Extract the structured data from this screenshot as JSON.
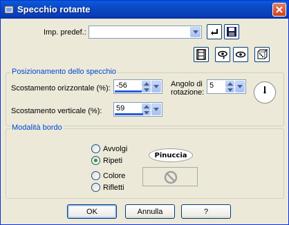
{
  "window": {
    "title": "Specchio rotante"
  },
  "preset": {
    "label": "Imp. predef.:",
    "value": ""
  },
  "mirror_group": {
    "legend": "Posizionamento dello specchio",
    "h_offset_label": "Scostamento orizzontale (%):",
    "h_offset_value": "-56",
    "v_offset_label": "Scostamento verticale (%):",
    "v_offset_value": "59",
    "angle_label_1": "Angolo di",
    "angle_label_2": "rotazione:",
    "angle_value": "5"
  },
  "edge_group": {
    "legend": "Modalità bordo",
    "options": [
      "Avvolgi",
      "Ripeti",
      "Colore",
      "Rifletti"
    ],
    "selected": "Ripeti",
    "logo_text": "Pinuccia"
  },
  "buttons": {
    "ok": "OK",
    "cancel": "Annulla",
    "help": "?"
  },
  "colors": {
    "titlebar": "#0a47c4",
    "legend": "#0046d5",
    "dialog_bg": "#ece9d8"
  }
}
